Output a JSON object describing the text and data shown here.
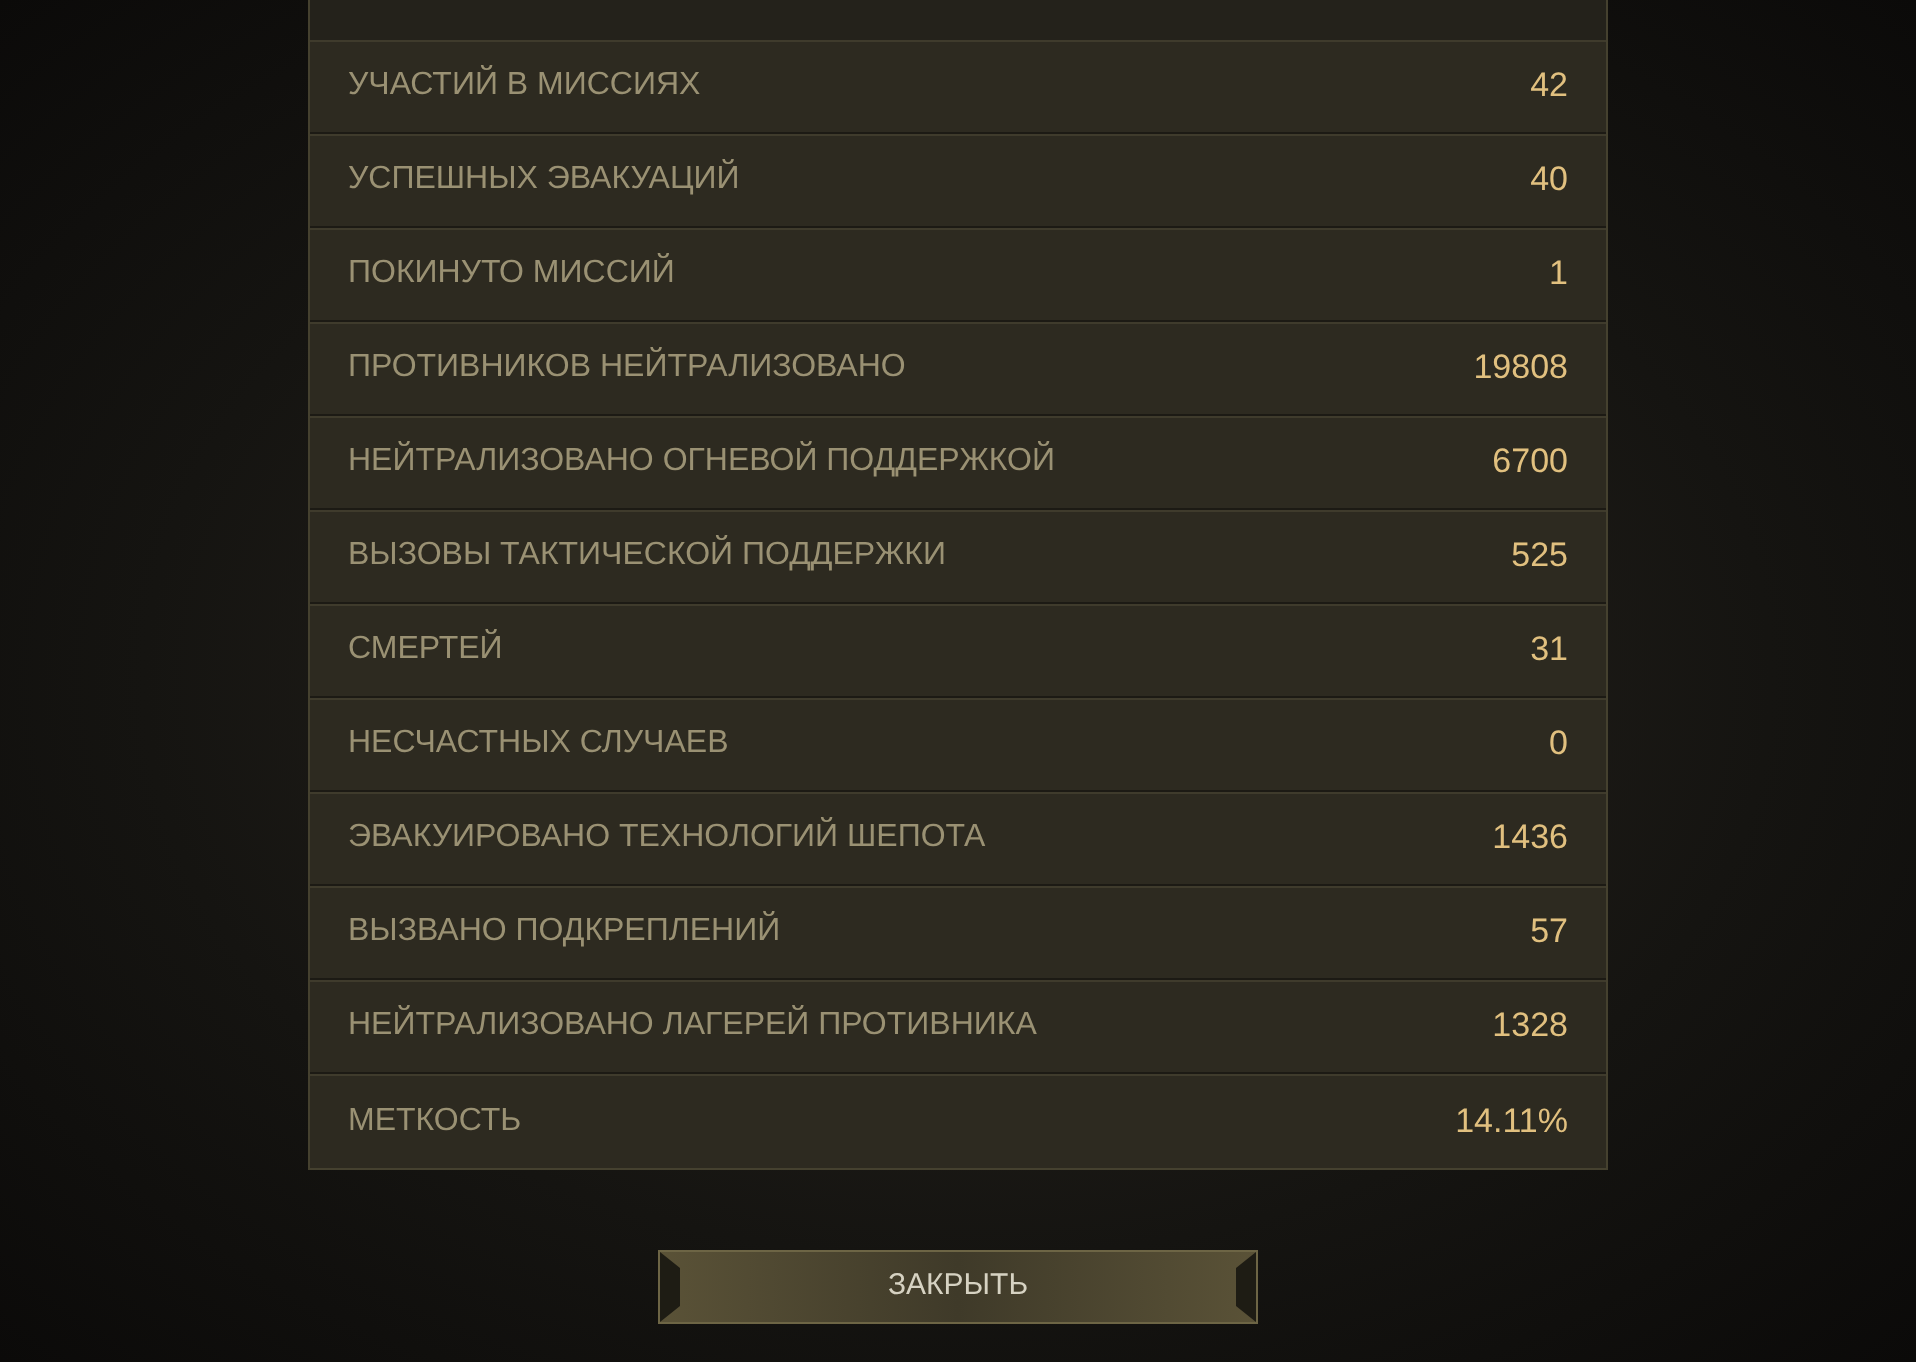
{
  "stats": [
    {
      "label": "УЧАСТИЙ В МИССИЯХ",
      "value": "42"
    },
    {
      "label": "УСПЕШНЫХ ЭВАКУАЦИЙ",
      "value": "40"
    },
    {
      "label": "ПОКИНУТО МИССИЙ",
      "value": "1"
    },
    {
      "label": "ПРОТИВНИКОВ НЕЙТРАЛИЗОВАНО",
      "value": "19808"
    },
    {
      "label": "НЕЙТРАЛИЗОВАНО ОГНЕВОЙ ПОДДЕРЖКОЙ",
      "value": "6700"
    },
    {
      "label": "ВЫЗОВЫ ТАКТИЧЕСКОЙ ПОДДЕРЖКИ",
      "value": "525"
    },
    {
      "label": "СМЕРТЕЙ",
      "value": "31"
    },
    {
      "label": "НЕСЧАСТНЫХ СЛУЧАЕВ",
      "value": "0"
    },
    {
      "label": "ЭВАКУИРОВАНО ТЕХНОЛОГИЙ ШЕПОТА",
      "value": "1436"
    },
    {
      "label": "ВЫЗВАНО ПОДКРЕПЛЕНИЙ",
      "value": "57"
    },
    {
      "label": "НЕЙТРАЛИЗОВАНО ЛАГЕРЕЙ ПРОТИВНИКА",
      "value": "1328"
    },
    {
      "label": "МЕТКОСТЬ",
      "value": "14.11%"
    }
  ],
  "close_button": "ЗАКРЫТЬ"
}
